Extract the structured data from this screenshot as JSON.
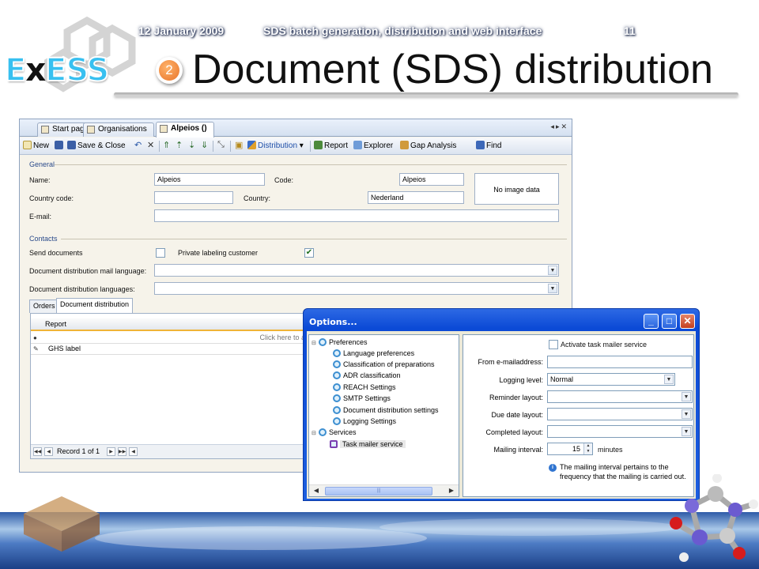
{
  "slide": {
    "logo_text": "ExESS",
    "step_number": "2",
    "title": "Document (SDS) distribution"
  },
  "app": {
    "tabs": [
      {
        "label": "Start page",
        "active": false
      },
      {
        "label": "Organisations",
        "active": false
      },
      {
        "label": "Alpeios ()",
        "active": true
      }
    ],
    "toolbar": {
      "new": "New",
      "save_close": "Save & Close",
      "distribution": "Distribution",
      "report": "Report",
      "explorer": "Explorer",
      "gap_analysis": "Gap Analysis",
      "find": "Find"
    },
    "general": {
      "section": "General",
      "name_label": "Name:",
      "name_value": "Alpeios",
      "code_label": "Code:",
      "code_value": "Alpeios",
      "country_code_label": "Country code:",
      "country_code_value": "",
      "country_label": "Country:",
      "country_value": "Nederland",
      "email_label": "E-mail:",
      "email_value": "",
      "image_placeholder": "No image data"
    },
    "contacts": {
      "section": "Contacts",
      "send_documents_label": "Send documents",
      "send_documents_checked": false,
      "private_labeling_label": "Private labeling customer",
      "private_labeling_checked": true,
      "mail_language_label": "Document distribution mail language:",
      "languages_label": "Document distribution languages:"
    },
    "subtabs": [
      {
        "label": "Orders",
        "active": false
      },
      {
        "label": "Document distribution",
        "active": true
      }
    ],
    "grid": {
      "column": "Report",
      "new_row_hint": "Click here to ad",
      "rows": [
        "GHS label"
      ],
      "record_text": "Record 1 of 1"
    }
  },
  "dialog": {
    "title": "Options...",
    "tree": [
      {
        "label": "Preferences",
        "level": 0
      },
      {
        "label": "Language preferences",
        "level": 1
      },
      {
        "label": "Classification of preparations",
        "level": 1
      },
      {
        "label": "ADR classification",
        "level": 1
      },
      {
        "label": "REACH Settings",
        "level": 1
      },
      {
        "label": "SMTP Settings",
        "level": 1
      },
      {
        "label": "Document distribution settings",
        "level": 1
      },
      {
        "label": "Logging Settings",
        "level": 1
      },
      {
        "label": "Services",
        "level": 0
      },
      {
        "label": "Task mailer service",
        "level": 1,
        "selected": true
      }
    ],
    "activate_label": "Activate task mailer service",
    "activate_checked": false,
    "from_label": "From e-mailaddress:",
    "from_value": "",
    "logging_label": "Logging level:",
    "logging_value": "Normal",
    "reminder_label": "Reminder layout:",
    "reminder_value": "",
    "due_label": "Due date layout:",
    "due_value": "",
    "completed_label": "Completed layout:",
    "completed_value": "",
    "interval_label": "Mailing interval:",
    "interval_value": "15",
    "interval_unit": "minutes",
    "info_text": "The mailing interval pertains to the frequency that the mailing is carried out."
  },
  "footer": {
    "date": "12 January 2009",
    "subtitle": "SDS batch generation, distribution and web interface",
    "page": "11"
  },
  "colors": {
    "dialog_titlebar": "#1c5fe0",
    "accent_badge": "#e8742a",
    "footer_blue": "#2d5aa8"
  }
}
